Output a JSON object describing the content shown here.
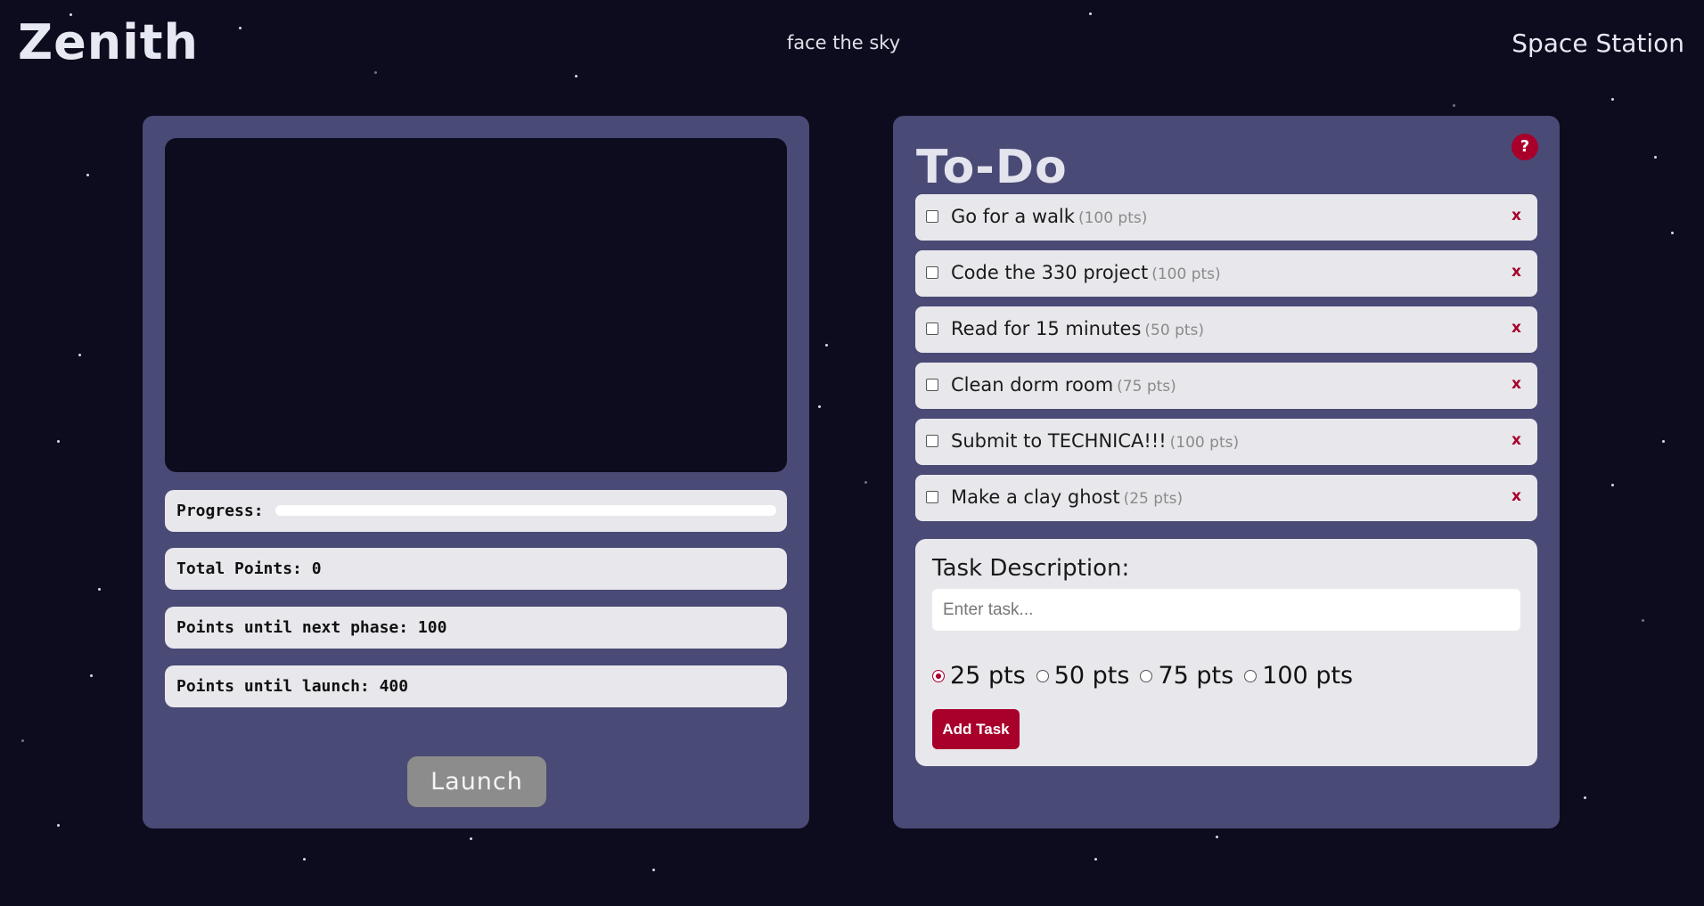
{
  "header": {
    "brand": "Zenith",
    "tagline": "face the sky",
    "nav_link": "Space Station"
  },
  "station": {
    "progress_label": "Progress:",
    "progress_value": 0,
    "total_points": "Total Points: 0",
    "next_phase": "Points until next phase: 100",
    "until_launch": "Points until launch: 400",
    "launch_label": "Launch"
  },
  "todo": {
    "title": "To-Do",
    "help_icon": "?",
    "remove_icon": "x",
    "tasks": [
      {
        "name": "Go for a walk",
        "pts": "(100 pts)"
      },
      {
        "name": "Code the 330 project",
        "pts": "(100 pts)"
      },
      {
        "name": "Read for 15 minutes",
        "pts": "(50 pts)"
      },
      {
        "name": "Clean dorm room",
        "pts": "(75 pts)"
      },
      {
        "name": "Submit to TECHNICA!!!",
        "pts": "(100 pts)"
      },
      {
        "name": "Make a clay ghost",
        "pts": "(25 pts)"
      }
    ],
    "form": {
      "label": "Task Description:",
      "placeholder": "Enter task...",
      "value": "",
      "options": [
        "25 pts",
        "50 pts",
        "75 pts",
        "100 pts"
      ],
      "selected": "25 pts",
      "add_label": "Add Task"
    }
  },
  "colors": {
    "background": "#0c0c1e",
    "panel": "#4a4a76",
    "accent": "#a8002a",
    "card": "#e8e8ec"
  }
}
